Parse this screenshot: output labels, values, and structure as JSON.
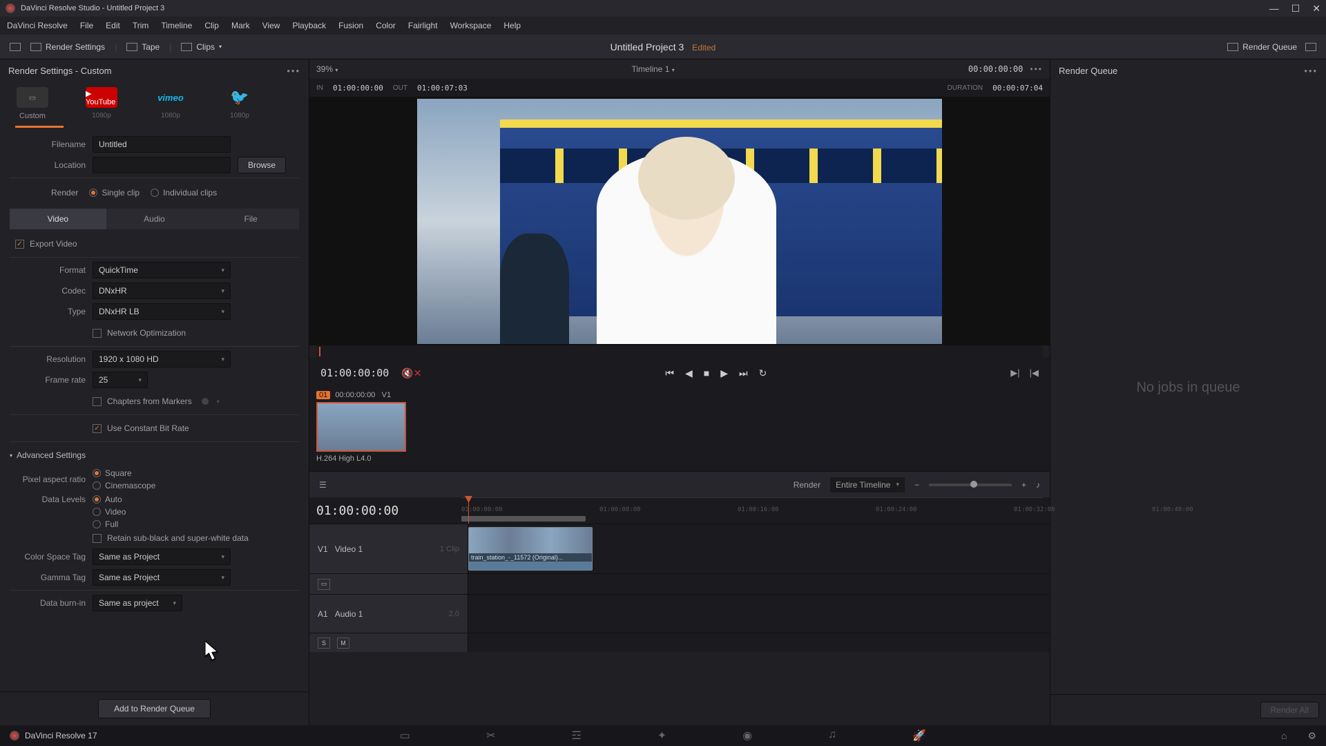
{
  "titlebar": {
    "text": "DaVinci Resolve Studio - Untitled Project 3"
  },
  "menu": [
    "DaVinci Resolve",
    "File",
    "Edit",
    "Trim",
    "Timeline",
    "Clip",
    "Mark",
    "View",
    "Playback",
    "Fusion",
    "Color",
    "Fairlight",
    "Workspace",
    "Help"
  ],
  "toolbar": {
    "render_settings": "Render Settings",
    "tape": "Tape",
    "clips": "Clips",
    "project_title": "Untitled Project 3",
    "edited": "Edited",
    "render_queue": "Render Queue"
  },
  "left": {
    "header": "Render Settings - Custom",
    "presets": [
      {
        "name": "Custom",
        "sub": ""
      },
      {
        "name": "YouTube",
        "sub": "1080p"
      },
      {
        "name": "vimeo",
        "sub": "1080p"
      },
      {
        "name": "Twitter",
        "sub": "1080p"
      }
    ],
    "filename_label": "Filename",
    "filename_value": "Untitled",
    "location_label": "Location",
    "location_value": "",
    "browse": "Browse",
    "render_label": "Render",
    "render_single": "Single clip",
    "render_individual": "Individual clips",
    "tabs": {
      "video": "Video",
      "audio": "Audio",
      "file": "File"
    },
    "export_video": "Export Video",
    "format_label": "Format",
    "format_value": "QuickTime",
    "codec_label": "Codec",
    "codec_value": "DNxHR",
    "type_label": "Type",
    "type_value": "DNxHR LB",
    "network_opt": "Network Optimization",
    "resolution_label": "Resolution",
    "resolution_value": "1920 x 1080 HD",
    "framerate_label": "Frame rate",
    "framerate_value": "25",
    "chapters": "Chapters from Markers",
    "cbr": "Use Constant Bit Rate",
    "advanced": "Advanced Settings",
    "par_label": "Pixel aspect ratio",
    "par_square": "Square",
    "par_cine": "Cinemascope",
    "dl_label": "Data Levels",
    "dl_auto": "Auto",
    "dl_video": "Video",
    "dl_full": "Full",
    "retain": "Retain sub-black and super-white data",
    "cst_label": "Color Space Tag",
    "cst_value": "Same as Project",
    "gamma_label": "Gamma Tag",
    "gamma_value": "Same as Project",
    "burnin_label": "Data burn-in",
    "burnin_value": "Same as project",
    "add_queue": "Add to Render Queue"
  },
  "viewer": {
    "zoom": "39%",
    "timeline_name": "Timeline 1",
    "tc_right": "00:00:00:00",
    "in_label": "IN",
    "in_value": "01:00:00:00",
    "out_label": "OUT",
    "out_value": "01:00:07:03",
    "dur_label": "DURATION",
    "dur_value": "00:00:07:04",
    "transport_tc": "01:00:00:00",
    "clip_num": "01",
    "clip_tc": "00:00:00:00",
    "clip_track": "V1",
    "clip_codec": "H.264 High L4.0"
  },
  "timeline": {
    "render_label": "Render",
    "render_scope": "Entire Timeline",
    "big_tc": "01:00:00:00",
    "ticks": [
      "01:00:00:00",
      "01:00:08:00",
      "01:00:16:00",
      "01:00:24:00",
      "01:00:32:00",
      "01:00:40:00"
    ],
    "v1": "V1",
    "v1_name": "Video 1",
    "v1_clips": "1 Clip",
    "a1": "A1",
    "a1_name": "Audio 1",
    "a1_ch": "2.0",
    "clip_name": "train_station_-_11572 (Original)..."
  },
  "right": {
    "header": "Render Queue",
    "empty": "No jobs in queue",
    "render_all": "Render All"
  },
  "footer": {
    "app": "DaVinci Resolve 17"
  }
}
